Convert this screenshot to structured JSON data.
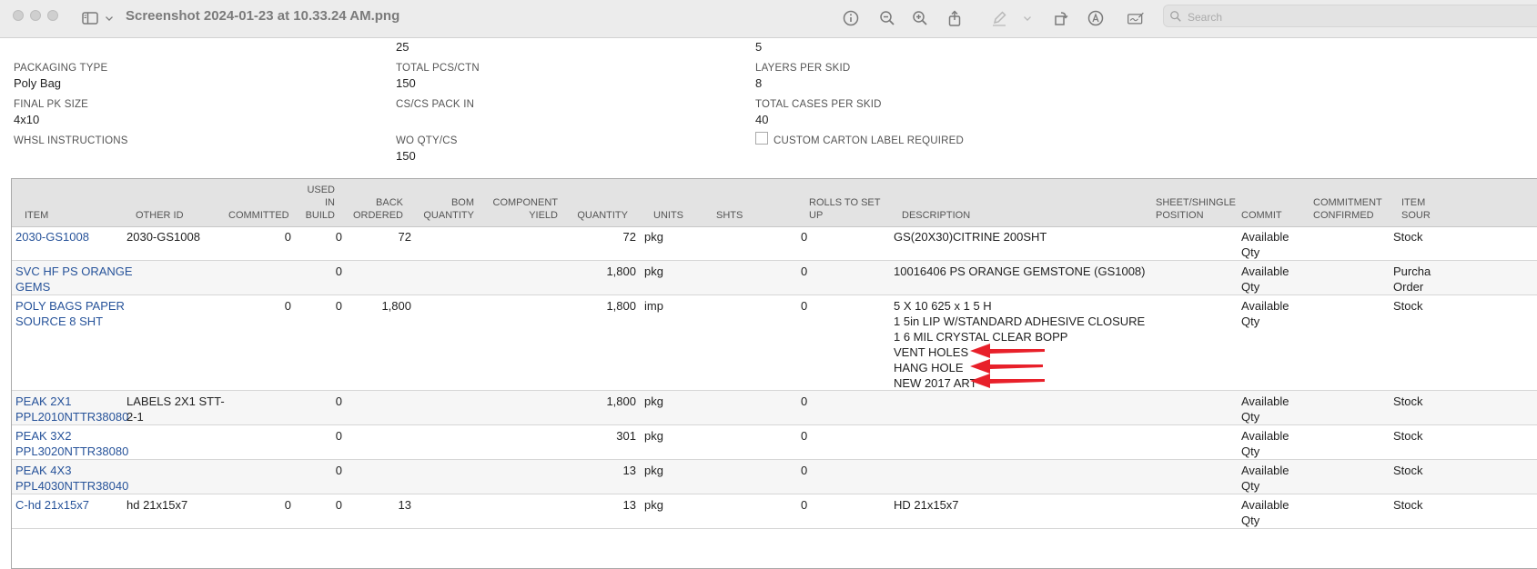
{
  "window": {
    "title": "Screenshot 2024-01-23 at 10.33.24 AM.png",
    "search_placeholder": "Search"
  },
  "form": {
    "top_values": [
      "25",
      "5"
    ],
    "fields": [
      {
        "label": "PACKAGING TYPE",
        "value": "Poly Bag"
      },
      {
        "label": "TOTAL PCS/CTN",
        "value": "150"
      },
      {
        "label": "LAYERS PER SKID",
        "value": "8"
      },
      {
        "label": "FINAL PK SIZE",
        "value": "4x10"
      },
      {
        "label": "CS/CS PACK IN",
        "value": ""
      },
      {
        "label": "TOTAL CASES PER SKID",
        "value": "40"
      },
      {
        "label": "WHSL INSTRUCTIONS",
        "value": ""
      },
      {
        "label": "WO QTY/CS",
        "value": "150"
      }
    ],
    "checkbox_label": "CUSTOM CARTON LABEL REQUIRED",
    "checkbox_checked": false
  },
  "table": {
    "headers": {
      "item": "ITEM",
      "other_id": "OTHER ID",
      "committed": "COMMITTED",
      "used_in_build": [
        "USED",
        "IN",
        "BUILD"
      ],
      "back_ordered": [
        "BACK",
        "ORDERED"
      ],
      "bom_quantity": [
        "BOM",
        "QUANTITY"
      ],
      "component_yield": [
        "COMPONENT",
        "YIELD"
      ],
      "quantity": "QUANTITY",
      "units": "UNITS",
      "shts": "SHTS",
      "rolls_to_set_up": [
        "ROLLS TO SET",
        "UP"
      ],
      "description": "DESCRIPTION",
      "sheet_shingle_position": [
        "SHEET/SHINGLE",
        "POSITION"
      ],
      "commit": "COMMIT",
      "commitment_confirmed": [
        "COMMITMENT",
        "CONFIRMED"
      ],
      "item_source": [
        "ITEM",
        "SOUR"
      ]
    },
    "rows": [
      {
        "item": [
          "2030-GS1008"
        ],
        "other_id": [
          "2030-GS1008"
        ],
        "committed": "0",
        "used_in_build": "0",
        "back_ordered": "72",
        "quantity": "72",
        "units": "pkg",
        "rolls": "0",
        "description": [
          "GS(20X30)CITRINE 200SHT"
        ],
        "commit": [
          "Available",
          "Qty"
        ],
        "source": [
          "Stock"
        ]
      },
      {
        "item": [
          "SVC HF PS ORANGE",
          "GEMS"
        ],
        "other_id": [],
        "committed": "",
        "used_in_build": "0",
        "back_ordered": "",
        "quantity": "1,800",
        "units": "pkg",
        "rolls": "0",
        "description": [
          "10016406 PS ORANGE GEMSTONE (GS1008)"
        ],
        "commit": [
          "Available",
          "Qty"
        ],
        "source": [
          "Purcha",
          "Order"
        ]
      },
      {
        "item": [
          "POLY BAGS PAPER",
          "SOURCE 8 SHT"
        ],
        "other_id": [],
        "committed": "0",
        "used_in_build": "0",
        "back_ordered": "1,800",
        "quantity": "1,800",
        "units": "imp",
        "rolls": "0",
        "description": [
          "5 X 10 625 x 1 5 H",
          "1 5in LIP W/STANDARD ADHESIVE CLOSURE",
          "1 6 MIL CRYSTAL CLEAR BOPP",
          "VENT HOLES",
          "HANG HOLE",
          "NEW 2017 ART"
        ],
        "commit": [
          "Available",
          "Qty"
        ],
        "source": [
          "Stock"
        ]
      },
      {
        "item": [
          "PEAK 2X1",
          "PPL2010NTTR38080"
        ],
        "other_id": [
          "LABELS 2X1 STT-",
          "2-1"
        ],
        "committed": "",
        "used_in_build": "0",
        "back_ordered": "",
        "quantity": "1,800",
        "units": "pkg",
        "rolls": "0",
        "description": [],
        "commit": [
          "Available",
          "Qty"
        ],
        "source": [
          "Stock"
        ]
      },
      {
        "item": [
          "PEAK 3X2",
          "PPL3020NTTR38080"
        ],
        "other_id": [],
        "committed": "",
        "used_in_build": "0",
        "back_ordered": "",
        "quantity": "301",
        "units": "pkg",
        "rolls": "0",
        "description": [],
        "commit": [
          "Available",
          "Qty"
        ],
        "source": [
          "Stock"
        ]
      },
      {
        "item": [
          "PEAK 4X3",
          "PPL4030NTTR38040"
        ],
        "other_id": [],
        "committed": "",
        "used_in_build": "0",
        "back_ordered": "",
        "quantity": "13",
        "units": "pkg",
        "rolls": "0",
        "description": [],
        "commit": [
          "Available",
          "Qty"
        ],
        "source": [
          "Stock"
        ]
      },
      {
        "item": [
          "C-hd 21x15x7"
        ],
        "other_id": [
          "hd 21x15x7"
        ],
        "committed": "0",
        "used_in_build": "0",
        "back_ordered": "13",
        "quantity": "13",
        "units": "pkg",
        "rolls": "0",
        "description": [
          "HD 21x15x7"
        ],
        "commit": [
          "Available",
          "Qty"
        ],
        "source": [
          "Stock"
        ]
      }
    ]
  },
  "colors": {
    "link": "#27539a",
    "arrow": "#e8202a",
    "header_bg": "#e3e3e3"
  }
}
